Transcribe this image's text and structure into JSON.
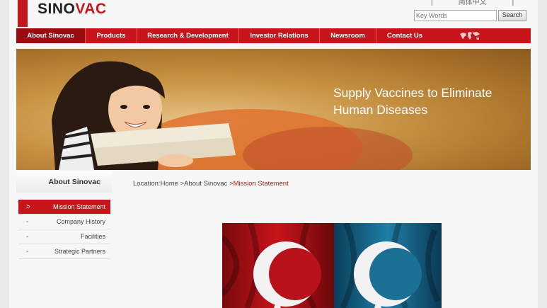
{
  "header": {
    "logo_main": "SINO",
    "logo_accent": "VAC",
    "lang_divider": "|",
    "lang_chinese": "简体中文",
    "search_placeholder": "Key Words",
    "search_button": "Search"
  },
  "nav": {
    "items": [
      {
        "label": "About Sinovac",
        "active": true
      },
      {
        "label": "Products"
      },
      {
        "label": "Research & Development"
      },
      {
        "label": "Investor Relations"
      },
      {
        "label": "Newsroom"
      },
      {
        "label": "Contact Us"
      }
    ]
  },
  "banner": {
    "line1": "Supply Vaccines to Eliminate",
    "line2": "Human Diseases"
  },
  "sidebar": {
    "title": "About Sinovac",
    "items": [
      {
        "label": "Mission Statement",
        "marker": ">",
        "active": true
      },
      {
        "label": "Company History",
        "marker": "-"
      },
      {
        "label": "Facilities",
        "marker": "-"
      },
      {
        "label": "Strategic Partners",
        "marker": "-"
      }
    ]
  },
  "breadcrumb": {
    "prefix": "Location:",
    "home": "Home",
    "sep": ">",
    "section": "About Sinovac",
    "current": "Mission Statement"
  },
  "colors": {
    "brand_red": "#c8141b",
    "active_nav": "#9b0c11"
  }
}
